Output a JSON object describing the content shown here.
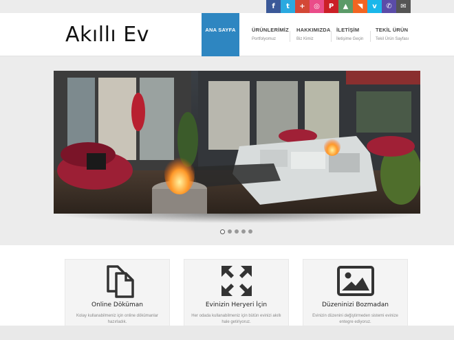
{
  "site": {
    "logo_text": "Akıllı Ev"
  },
  "social": [
    {
      "icon": "facebook-icon",
      "glyph": "f",
      "color": "#3b5998"
    },
    {
      "icon": "twitter-icon",
      "glyph": "t",
      "color": "#2aa9e0"
    },
    {
      "icon": "google-plus-icon",
      "glyph": "+",
      "color": "#d34836"
    },
    {
      "icon": "dribbble-icon",
      "glyph": "◎",
      "color": "#ea4c89"
    },
    {
      "icon": "pinterest-icon",
      "glyph": "P",
      "color": "#cb2027"
    },
    {
      "icon": "forrst-icon",
      "glyph": "▲",
      "color": "#5b9a68"
    },
    {
      "icon": "rss-icon",
      "glyph": "◥",
      "color": "#f26522"
    },
    {
      "icon": "vimeo-icon",
      "glyph": "v",
      "color": "#1ab7ea"
    },
    {
      "icon": "phone-icon",
      "glyph": "✆",
      "color": "#5b4ca8"
    },
    {
      "icon": "mail-icon",
      "glyph": "✉",
      "color": "#555555"
    }
  ],
  "nav": [
    {
      "label": "ANA SAYFA",
      "sub": ""
    },
    {
      "label": "ÜRÜNLERİMİZ",
      "sub": "Portfolyomuz"
    },
    {
      "label": "HAKKIMIZDA",
      "sub": "Biz Kimiz"
    },
    {
      "label": "İLETİŞİM",
      "sub": "İletişime Geçin"
    },
    {
      "label": "TEKİL ÜRÜN",
      "sub": "Tekil Ürün Sayfası"
    }
  ],
  "slider": {
    "dot_count": 5,
    "active_index": 0
  },
  "features": [
    {
      "icon": "documents-icon",
      "title": "Online Döküman",
      "desc": "Kolay kullanabilmeniz için online dökümanlar hazırladık."
    },
    {
      "icon": "expand-arrows-icon",
      "title": "Evinizin Heryeri İçin",
      "desc": "Her odada kullanabilmeniz için bütün evinizi akıllı hale getiriyoruz."
    },
    {
      "icon": "picture-icon",
      "title": "Düzeninizi Bozmadan",
      "desc": "Evinizin düzenini değiştirmeden sistemi evinize entegre ediyoruz."
    }
  ],
  "colors": {
    "accent": "#2e86c1"
  }
}
